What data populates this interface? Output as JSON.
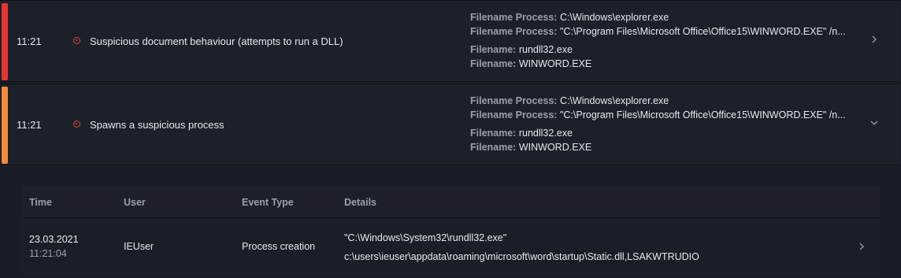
{
  "alerts": [
    {
      "time": "11:21",
      "title": "Suspicious document behaviour (attempts to run a DLL)",
      "severity_color": "#e53532",
      "details": [
        {
          "key": "Filename Process:",
          "value": "C:\\Windows\\explorer.exe"
        },
        {
          "key": "Filename Process:",
          "value": "\"C:\\Program Files\\Microsoft Office\\Office15\\WINWORD.EXE\" /n..."
        },
        {
          "key": "Filename:",
          "value": "rundll32.exe"
        },
        {
          "key": "Filename:",
          "value": "WINWORD.EXE"
        }
      ],
      "chevron": "chevron-right-icon"
    },
    {
      "time": "11:21",
      "title": "Spawns a suspicious process",
      "severity_color": "#f08a3c",
      "details": [
        {
          "key": "Filename Process:",
          "value": "C:\\Windows\\explorer.exe"
        },
        {
          "key": "Filename Process:",
          "value": "\"C:\\Program Files\\Microsoft Office\\Office15\\WINWORD.EXE\" /n..."
        },
        {
          "key": "Filename:",
          "value": "rundll32.exe"
        },
        {
          "key": "Filename:",
          "value": "WINWORD.EXE"
        }
      ],
      "chevron": "chevron-down-icon"
    }
  ],
  "events": {
    "headers": {
      "time": "Time",
      "user": "User",
      "event_type": "Event Type",
      "details": "Details"
    },
    "rows": [
      {
        "date": "23.03.2021",
        "time": "11:21:04",
        "user": "IEUser",
        "event_type": "Process creation",
        "details_line1": "\"C:\\Windows\\System32\\rundll32.exe\"",
        "details_line2": "c:\\users\\ieuser\\appdata\\roaming\\microsoft\\word\\startup\\Static.dll,LSAKWTRUDIO"
      }
    ]
  },
  "colors": {
    "background": "#181c24",
    "panel": "#1c2029",
    "label": "#9aa0ab",
    "alert_icon": "#e2463e"
  }
}
